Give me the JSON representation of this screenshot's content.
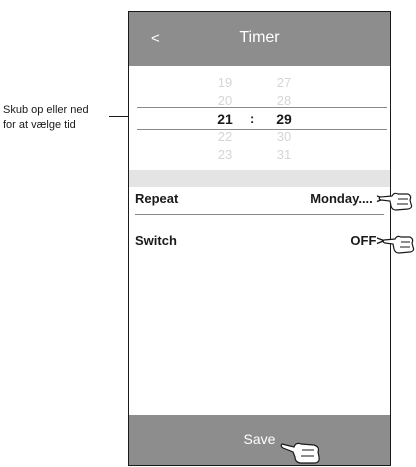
{
  "header": {
    "back": "<",
    "title": "Timer"
  },
  "picker": {
    "hours": [
      "19",
      "20",
      "21",
      "22",
      "23"
    ],
    "minutes": [
      "27",
      "28",
      "29",
      "30",
      "31"
    ],
    "separator": ":",
    "selected_hour": "21",
    "selected_minute": "29"
  },
  "settings": {
    "repeat": {
      "label": "Repeat",
      "value": "Monday.... >"
    },
    "switch": {
      "label": "Switch",
      "value": "OFF>"
    }
  },
  "save": {
    "label": "Save"
  },
  "annotation": {
    "line1": "Skub op eller ned",
    "line2": "for at vælge tid"
  },
  "icons": [
    "pointing-hand-icon"
  ],
  "colors": {
    "bar": "#8d8d8d",
    "gap": "#e4e4e4",
    "picker_dim": "#d5d5d5",
    "text": "#1a1a1a"
  }
}
